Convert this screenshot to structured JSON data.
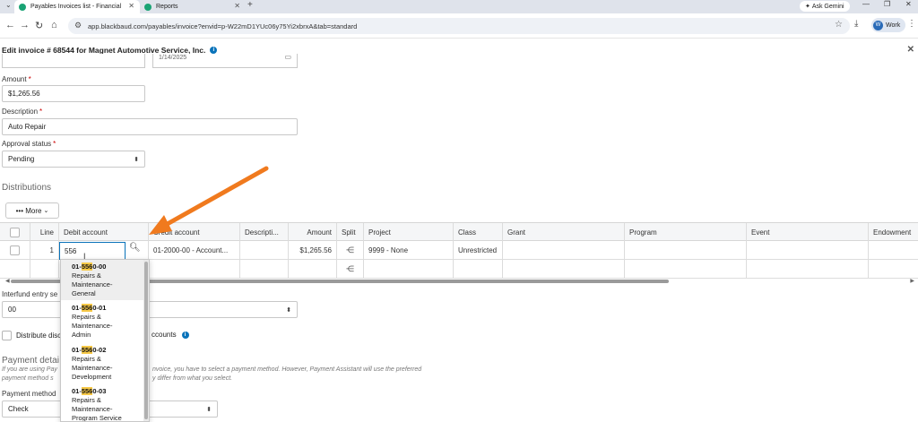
{
  "browser": {
    "tabs": [
      {
        "label": "Payables Invoices list - Financial",
        "active": true
      },
      {
        "label": "Reports",
        "active": false
      }
    ],
    "gemini_label": "Ask Gemini",
    "url": "app.blackbaud.com/payables/invoice?envid=p-W22mD1YUc06y75Yi2xbrxA&tab=standard",
    "profile_label": "Work",
    "profile_initial": "W"
  },
  "page": {
    "title": "Edit invoice # 68544 for Magnet Automotive Service, Inc.",
    "date_fragment": "1/14/2025"
  },
  "form": {
    "amount_label": "Amount",
    "amount_value": "$1,265.56",
    "description_label": "Description",
    "description_value": "Auto Repair",
    "approval_label": "Approval status",
    "approval_value": "Pending"
  },
  "distributions": {
    "heading": "Distributions",
    "more_label": "••• More",
    "columns": [
      "Line",
      "Debit account",
      "Credit account",
      "Descripti...",
      "Amount",
      "Split",
      "Project",
      "Class",
      "Grant",
      "Program",
      "Event",
      "Endowment"
    ],
    "row1": {
      "line": "1",
      "debit_typed": "556",
      "credit": "01-2000-00 - Account...",
      "amount": "$1,265.56",
      "project": "9999 - None",
      "class": "Unrestricted"
    }
  },
  "dropdown": {
    "items": [
      {
        "prefix": "01-",
        "match": "556",
        "suffix": "0-00",
        "lines": [
          "Repairs &",
          "Maintenance-",
          "General"
        ]
      },
      {
        "prefix": "01-",
        "match": "556",
        "suffix": "0-01",
        "lines": [
          "Repairs &",
          "Maintenance-",
          "Admin"
        ]
      },
      {
        "prefix": "01-",
        "match": "556",
        "suffix": "0-02",
        "lines": [
          "Repairs &",
          "Maintenance-",
          "Development"
        ]
      },
      {
        "prefix": "01-",
        "match": "556",
        "suffix": "0-03",
        "lines": [
          "Repairs &",
          "Maintenance-",
          "Program Service"
        ]
      }
    ]
  },
  "lower": {
    "interfund_label": "Interfund entry se",
    "interfund_value": "00",
    "distribute_label": "Distribute disc",
    "distribute_tail": "ccounts",
    "payment_heading": "Payment detai",
    "payment_note_1a": "If you are using Pay",
    "payment_note_1b": "nvoice, you have to select a payment method. However, Payment Assistant will use the preferred",
    "payment_note_2a": "payment method s",
    "payment_note_2b": "y differ from what you select.",
    "payment_method_label": "Payment method",
    "payment_method_value": "Check"
  },
  "colors": {
    "accent": "#0973ba",
    "arrow": "#f07a1e",
    "highlight": "#f7c948"
  }
}
